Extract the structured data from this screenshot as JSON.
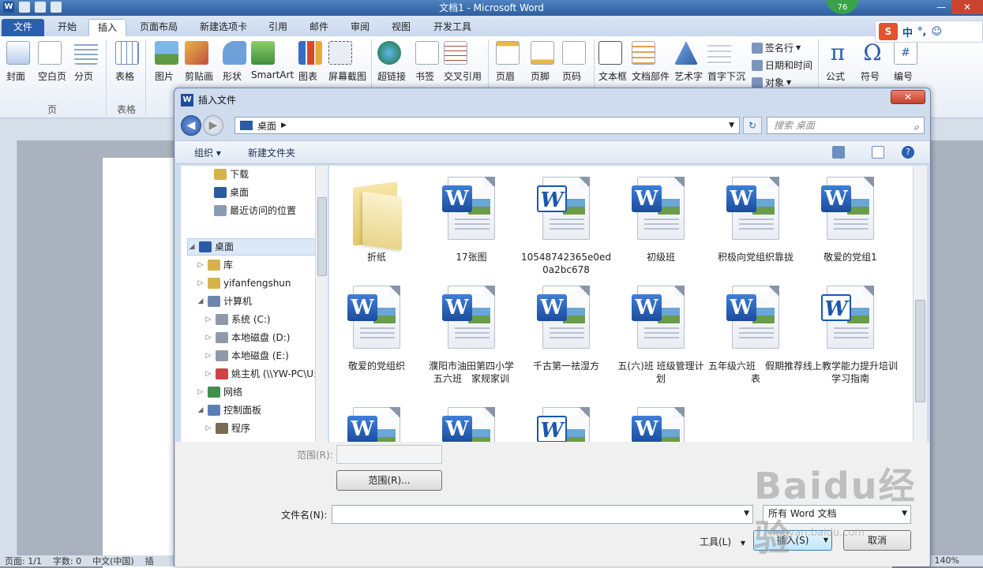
{
  "app": {
    "title": "文档1 - Microsoft Word",
    "qat_logo": "W",
    "badge": "76",
    "window_buttons": {
      "minimize": "—",
      "maximize": "□",
      "close": "✕"
    }
  },
  "ribbon_tabs": [
    {
      "label": "文件"
    },
    {
      "label": "开始"
    },
    {
      "label": "插入"
    },
    {
      "label": "页面布局"
    },
    {
      "label": "新建选项卡"
    },
    {
      "label": "引用"
    },
    {
      "label": "邮件"
    },
    {
      "label": "审阅"
    },
    {
      "label": "视图"
    },
    {
      "label": "开发工具"
    }
  ],
  "ime": {
    "logo": "S",
    "mode": "中",
    "punct": "°,",
    "face": "☺"
  },
  "ribbon": {
    "buttons": [
      {
        "label": "封面"
      },
      {
        "label": "空白页"
      },
      {
        "label": "分页"
      },
      {
        "label": "表格"
      },
      {
        "label": "图片"
      },
      {
        "label": "剪贴画"
      },
      {
        "label": "形状"
      },
      {
        "label": "SmartArt"
      },
      {
        "label": "图表"
      },
      {
        "label": "屏幕截图"
      },
      {
        "label": "超链接"
      },
      {
        "label": "书签"
      },
      {
        "label": "交叉引用"
      },
      {
        "label": "页眉"
      },
      {
        "label": "页脚"
      },
      {
        "label": "页码"
      },
      {
        "label": "文本框"
      },
      {
        "label": "文档部件"
      },
      {
        "label": "艺术字"
      },
      {
        "label": "首字下沉"
      },
      {
        "label": "公式"
      },
      {
        "label": "符号"
      },
      {
        "label": "编号"
      }
    ],
    "small": {
      "signature": "签名行",
      "datetime": "日期和时间",
      "object": "对象"
    },
    "groups": {
      "pages": "页",
      "table": "表格"
    }
  },
  "status": {
    "page": "页面: 1/1",
    "words": "字数: 0",
    "lang": "中文(中国)",
    "insert": "插",
    "zoom": "140%"
  },
  "dialog": {
    "title": "插入文件",
    "close": "✕",
    "address": "桌面",
    "search_placeholder": "搜索 桌面",
    "toolbar": {
      "organize": "组织 ▾",
      "new_folder": "新建文件夹"
    },
    "nav_items": [
      {
        "label": "下载",
        "color": "#d7b24a"
      },
      {
        "label": "桌面",
        "color": "#2c5aa3"
      },
      {
        "label": "最近访问的位置",
        "color": "#8a9bb5"
      },
      {
        "label": "桌面",
        "color": "#2c5aa3"
      },
      {
        "label": "库",
        "color": "#d7b24a"
      },
      {
        "label": "yifanfengshun",
        "color": "#d7b24a"
      },
      {
        "label": "计算机",
        "color": "#6c86ac"
      },
      {
        "label": "系统 (C:)",
        "color": "#8e9aa8"
      },
      {
        "label": "本地磁盘 (D:)",
        "color": "#8e9aa8"
      },
      {
        "label": "本地磁盘 (E:)",
        "color": "#8e9aa8"
      },
      {
        "label": "姚主机 (\\\\YW-PC\\U:",
        "color": "#c44"
      },
      {
        "label": "网络",
        "color": "#3f8f4f"
      },
      {
        "label": "控制面板",
        "color": "#5a7fb5"
      },
      {
        "label": "程序",
        "color": "#7a6b55"
      }
    ],
    "files": [
      {
        "label": "折纸",
        "type": "folder"
      },
      {
        "label": "17张图",
        "type": "docx"
      },
      {
        "label": "10548742365e0ed0a2bc678",
        "type": "doc"
      },
      {
        "label": "初级班",
        "type": "docx"
      },
      {
        "label": "积极向党组织靠拢",
        "type": "docx"
      },
      {
        "label": "敬爱的党组1",
        "type": "docx"
      },
      {
        "label": "敬爱的党组织",
        "type": "docx"
      },
      {
        "label": "濮阳市油田第四小学　五六班　家规家训",
        "type": "docx"
      },
      {
        "label": "千古第一祛湿方",
        "type": "docx"
      },
      {
        "label": "五(六)班 班级管理计划",
        "type": "docx"
      },
      {
        "label": "五年级六班　假期推荐表",
        "type": "docx"
      },
      {
        "label": "线上教学能力提升培训学习指南",
        "type": "doc"
      },
      {
        "label": "",
        "type": "docx"
      },
      {
        "label": "",
        "type": "docx"
      },
      {
        "label": "",
        "type": "doc"
      },
      {
        "label": "",
        "type": "docx"
      }
    ],
    "range_label": "范围(R):",
    "range_button": "范围(R)...",
    "filename_label": "文件名(N):",
    "filename_value": "",
    "filetype": "所有 Word 文档",
    "tools": "工具(L)",
    "insert": "插入(S)",
    "cancel": "取消"
  },
  "watermark": {
    "text": "Baidu经验",
    "url": "jingyan.baidu.com"
  }
}
